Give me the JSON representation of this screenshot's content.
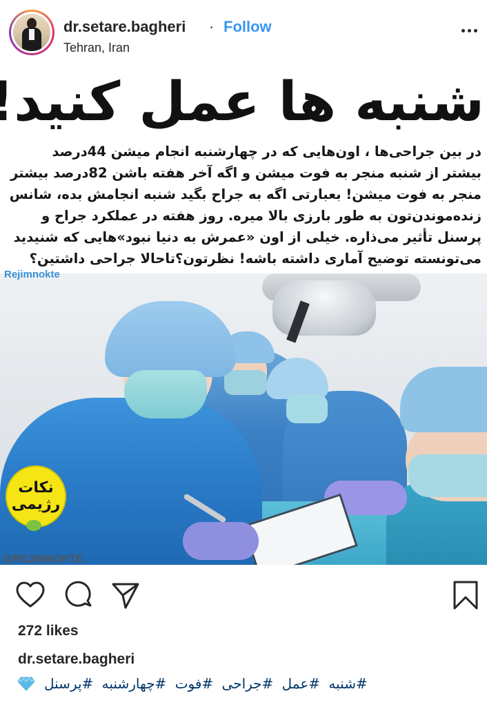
{
  "header": {
    "username": "dr.setare.bagheri",
    "separator": "·",
    "follow_label": "Follow",
    "location": "Tehran, Iran",
    "more_icon": "more-horizontal-icon"
  },
  "post_image": {
    "headline": "شنبه ها عمل کنید!",
    "paragraph_lines": [
      "در بین جراحی‌ها ، اون‌هایی که در چهارشنبه انجام میشن 44درصد",
      "بیشتر از شنبه منجر به فوت میشن  و اگه آخر هفته باشن 82درصد بیشتر",
      "منجر به فوت میشن! بعبارتی اگه به جراح بگید شنبه انجامش بده، شانس",
      "زنده‌موندن‌تون به طور بارزی بالا میره. روز هفته در عملکرد جراح و",
      "پرسنل تأثیر می‌ذاره. خیلی از اون «عمرش به دنیا نبود»هایی که شنیدید",
      "می‌تونسته توضیح آماری داشته باشه! نظرتون؟تاحالا جراحی داشتین؟"
    ],
    "watermark_top": "Rejimnokte",
    "logo_line1": "نکات",
    "logo_line2": "رژیمی",
    "watermark_bottom": "@REJIMNOKTE"
  },
  "actions": {
    "like_icon": "heart-icon",
    "comment_icon": "comment-icon",
    "share_icon": "share-icon",
    "save_icon": "bookmark-icon"
  },
  "likes": "272 likes",
  "caption": {
    "username": "dr.setare.bagheri",
    "emoji": "gem-icon",
    "hashtags": [
      "#شنبه",
      "#عمل",
      "#جراحی",
      "#فوت",
      "#چهارشنبه",
      "#پرسنل"
    ]
  },
  "colors": {
    "follow": "#3897f0",
    "hashtag": "#003569",
    "text": "#262626"
  }
}
